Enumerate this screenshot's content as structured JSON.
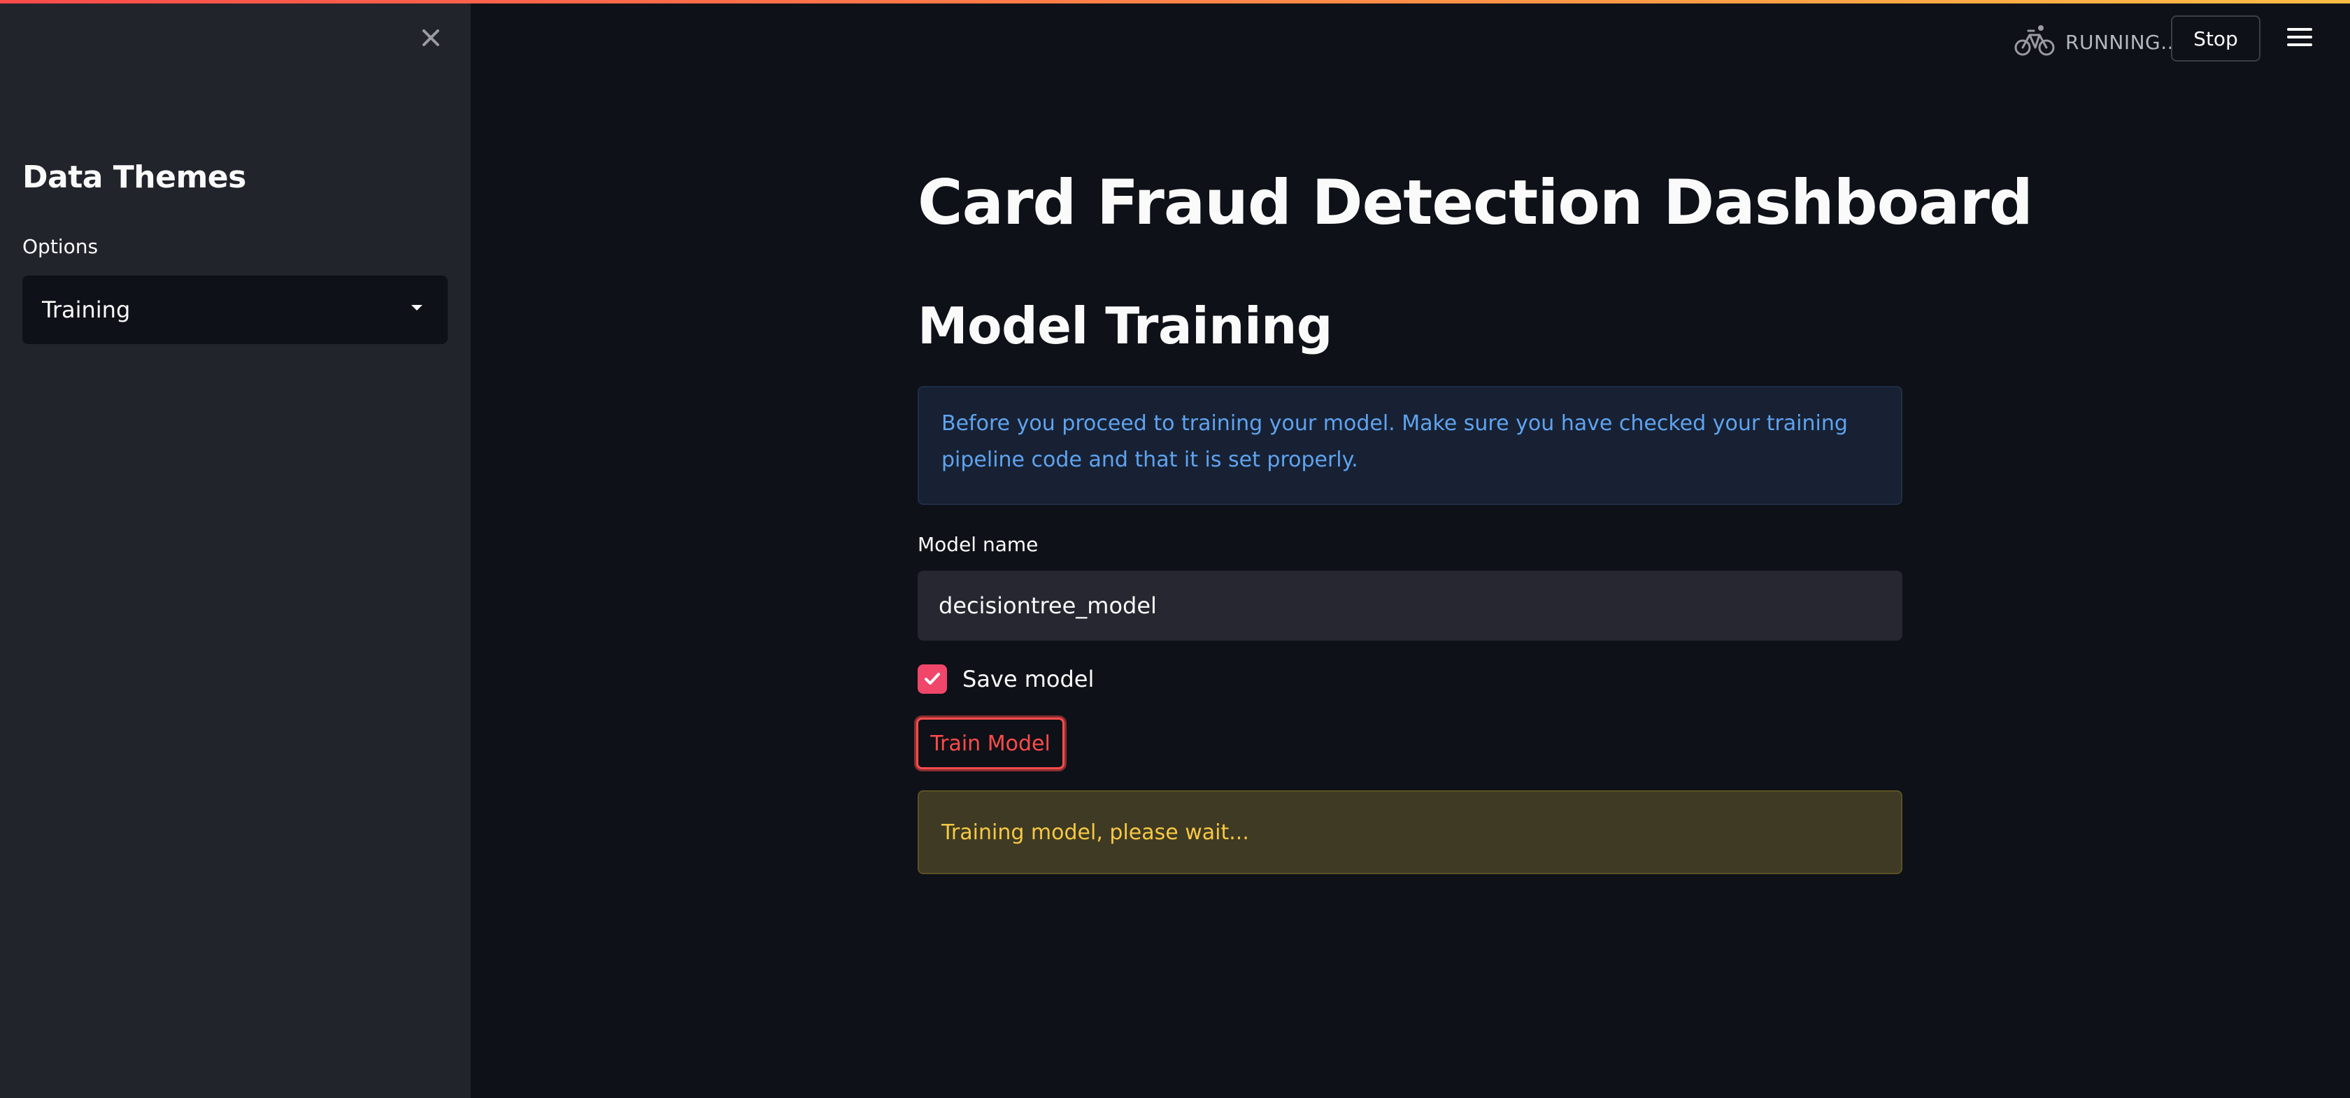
{
  "sidebar": {
    "close_icon": "close-icon",
    "title": "Data Themes",
    "select_label": "Options",
    "select_value": "Training"
  },
  "header": {
    "status_icon": "bicycle-icon",
    "status_text": "RUNNING...",
    "stop_label": "Stop",
    "menu_icon": "hamburger-menu-icon"
  },
  "main": {
    "title": "Card Fraud Detection Dashboard",
    "section_title": "Model Training",
    "info_message": "Before you proceed to training your model. Make sure you have checked your training pipeline code and that it is set properly.",
    "model_name_label": "Model name",
    "model_name_value": "decisiontree_model",
    "save_model_label": "Save model",
    "save_model_checked": true,
    "train_button_label": "Train Model",
    "warning_message": "Training model, please wait..."
  },
  "colors": {
    "background": "#0e1117",
    "sidebar": "#22242b",
    "accent": "#ff4b4b",
    "info_text": "#5fa3f0",
    "warning_text": "#f7c844"
  }
}
